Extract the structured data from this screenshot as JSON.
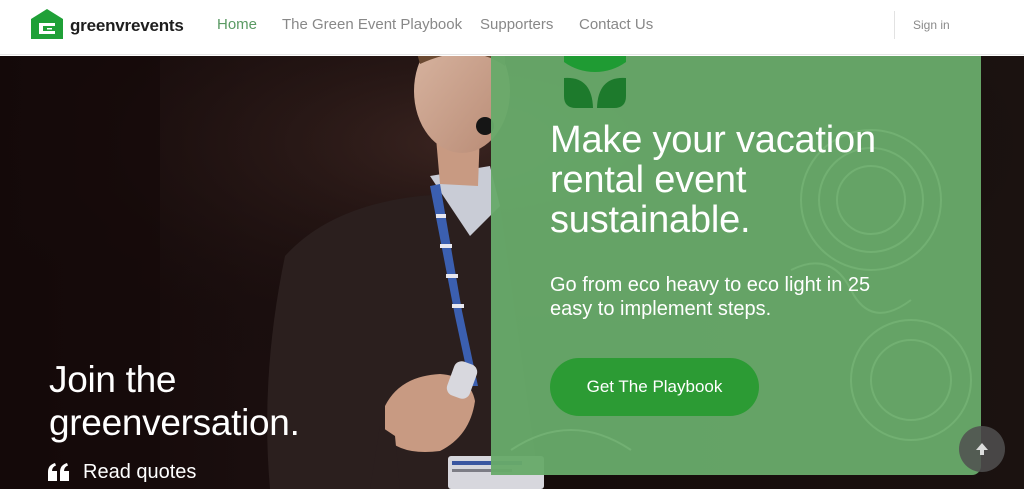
{
  "brand": {
    "name": "greenvrevents",
    "logo_icon": "green-house-g-icon",
    "accent_color": "#5a9a63",
    "logo_color": "#20a03a"
  },
  "nav": {
    "items": [
      {
        "label": "Home",
        "active": true
      },
      {
        "label": "The Green Event Playbook",
        "active": false
      },
      {
        "label": "Supporters",
        "active": false
      },
      {
        "label": "Contact Us",
        "active": false
      }
    ],
    "sign_in": "Sign in"
  },
  "hero": {
    "left_title": "Join the greenversation.",
    "quotes_icon": "quote-icon",
    "quotes_label": "Read quotes",
    "photo_description_icon": "speaker-photo"
  },
  "promo": {
    "logo_icon": "leaf-g-icon",
    "title": "Make your vacation rental event sustainable.",
    "subtitle": "Go from eco heavy to eco light in 25 easy to implement steps.",
    "cta_label": "Get The Playbook",
    "card_color": "#68aa6a",
    "cta_color": "#2c9b34"
  },
  "scroll_button": {
    "icon": "arrow-up-icon"
  }
}
